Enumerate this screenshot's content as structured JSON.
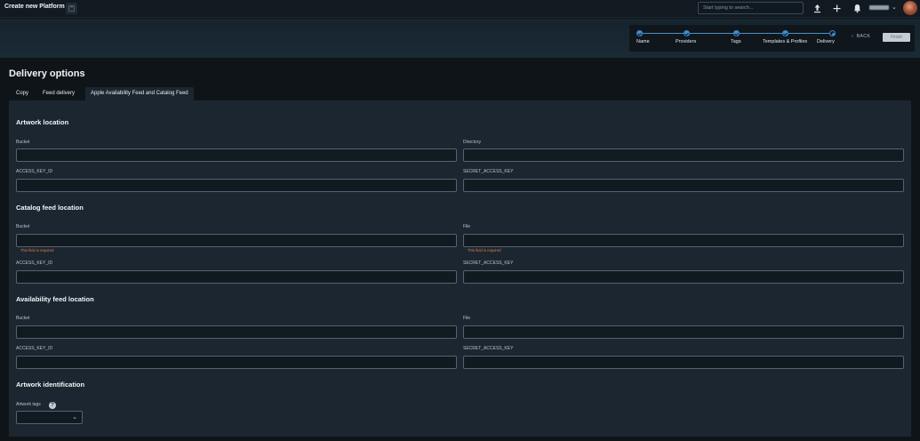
{
  "topbar": {
    "title": "Create new Platform",
    "search_placeholder": "Start typing to search..."
  },
  "stepper": {
    "steps": [
      {
        "label": "Name"
      },
      {
        "label": "Providers"
      },
      {
        "label": "Tags"
      },
      {
        "label": "Templates & Profiles"
      },
      {
        "label": "Delivery"
      }
    ],
    "back_label": "BACK",
    "finish_label": "Finish",
    "accent": "#3f8bd3"
  },
  "page": {
    "title": "Delivery options",
    "tabs": [
      {
        "label": "Copy"
      },
      {
        "label": "Feed delivery"
      },
      {
        "label": "Apple Availability Feed and Catalog Feed"
      }
    ]
  },
  "sections": {
    "artwork_location": {
      "title": "Artwork location",
      "bucket": "Bucket",
      "directory": "Directory",
      "access_key": "ACCESS_KEY_ID",
      "secret_key": "SECRET_ACCESS_KEY"
    },
    "catalog_feed": {
      "title": "Catalog feed location",
      "bucket": "Bucket",
      "file": "File",
      "bucket_error": "This field is required",
      "file_error": "This field is required",
      "access_key": "ACCESS_KEY_ID",
      "secret_key": "SECRET_ACCESS_KEY"
    },
    "availability_feed": {
      "title": "Availability feed location",
      "bucket": "Bucket",
      "file": "File",
      "access_key": "ACCESS_KEY_ID",
      "secret_key": "SECRET_ACCESS_KEY"
    },
    "artwork_identification": {
      "title": "Artwork identification",
      "tags_label": "Artwork tags"
    }
  },
  "colors": {
    "background": "#0f1419",
    "panel": "#1b2630",
    "error": "#e9784f"
  }
}
